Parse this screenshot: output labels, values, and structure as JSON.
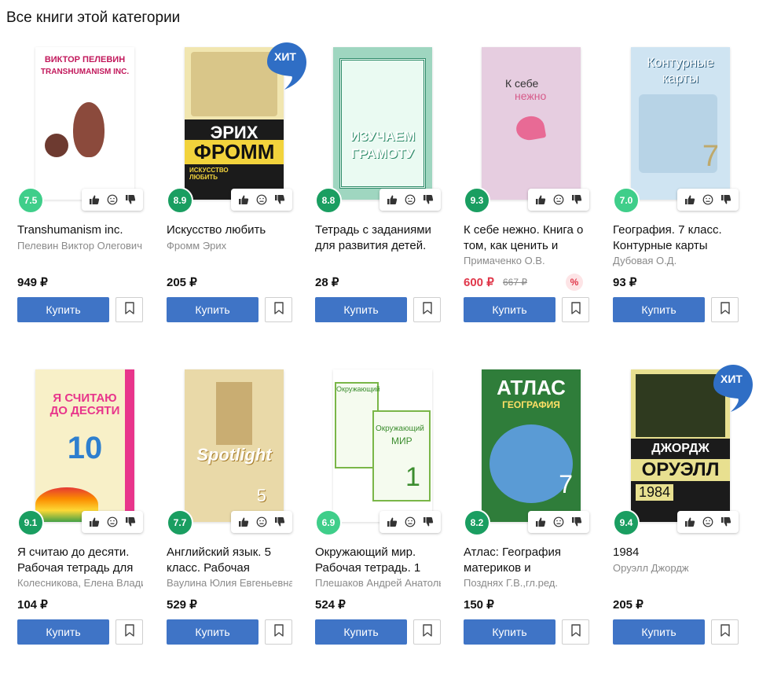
{
  "section": {
    "title": "Все книги этой категории"
  },
  "buy_label": "Купить",
  "books": [
    {
      "title": "Transhumanism inc.",
      "author": "Пелевин Виктор Олегович",
      "price": "949 ₽",
      "old_price": "",
      "discount_badge": "",
      "rating": "7.5",
      "rating_color": "#3fce8a",
      "hit": "",
      "cover_text": [
        "ВИКТОР ПЕЛЕВИН",
        "TRANSHUMANISM INC."
      ]
    },
    {
      "title": "Искусство любить",
      "author": "Фромм Эрих",
      "price": "205 ₽",
      "old_price": "",
      "discount_badge": "",
      "rating": "8.9",
      "rating_color": "#1a9e61",
      "hit": "ХИТ",
      "cover_text": [
        "ЭРИХ",
        "ФРОММ",
        "ИСКУССТВО ЛЮБИТЬ"
      ]
    },
    {
      "title": "Тетрадь с заданиями для развития детей.",
      "author": "",
      "price": "28 ₽",
      "old_price": "",
      "discount_badge": "",
      "rating": "8.8",
      "rating_color": "#1a9e61",
      "hit": "",
      "cover_text": [
        "ИЗУЧАЕМ",
        "ГРАМОТУ"
      ]
    },
    {
      "title": "К себе нежно. Книга о том, как ценить и",
      "author": "Примаченко О.В.",
      "price": "600 ₽",
      "old_price": "667 ₽",
      "discount_badge": "%",
      "rating": "9.3",
      "rating_color": "#1a9e61",
      "hit": "",
      "cover_text": [
        "К себе",
        "нежно"
      ]
    },
    {
      "title": "География. 7 класс. Контурные карты",
      "author": "Дубовая О.Д.",
      "price": "93 ₽",
      "old_price": "",
      "discount_badge": "",
      "rating": "7.0",
      "rating_color": "#3fce8a",
      "hit": "",
      "cover_text": [
        "Контурные",
        "карты",
        "7"
      ]
    },
    {
      "title": "Я считаю до десяти. Рабочая тетрадь для",
      "author": "Колесникова, Елена Владимировна",
      "price": "104 ₽",
      "old_price": "",
      "discount_badge": "",
      "rating": "9.1",
      "rating_color": "#1a9e61",
      "hit": "",
      "cover_text": [
        "Я СЧИТАЮ",
        "ДО ДЕСЯТИ",
        "10"
      ]
    },
    {
      "title": "Английский язык. 5 класс. Рабочая",
      "author": "Ваулина Юлия Евгеньевна",
      "price": "529 ₽",
      "old_price": "",
      "discount_badge": "",
      "rating": "7.7",
      "rating_color": "#1a9e61",
      "hit": "",
      "cover_text": [
        "Spotlight",
        "5"
      ]
    },
    {
      "title": "Окружающий мир. Рабочая тетрадь. 1",
      "author": "Плешаков Андрей Анатольевич",
      "price": "524 ₽",
      "old_price": "",
      "discount_badge": "",
      "rating": "6.9",
      "rating_color": "#3fce8a",
      "hit": "",
      "cover_text": [
        "Окружающий",
        "МИР",
        "1"
      ]
    },
    {
      "title": "Атлас: География материков и",
      "author": "Позднях Г.В.,гл.ред.",
      "price": "150 ₽",
      "old_price": "",
      "discount_badge": "",
      "rating": "8.2",
      "rating_color": "#1a9e61",
      "hit": "",
      "cover_text": [
        "АТЛАС",
        "ГЕОГРАФИЯ",
        "7"
      ]
    },
    {
      "title": "1984",
      "author": "Оруэлл Джордж",
      "price": "205 ₽",
      "old_price": "",
      "discount_badge": "",
      "rating": "9.4",
      "rating_color": "#1a9e61",
      "hit": "ХИТ",
      "cover_text": [
        "ДЖОРДЖ",
        "ОРУЭЛЛ",
        "1984"
      ]
    }
  ]
}
